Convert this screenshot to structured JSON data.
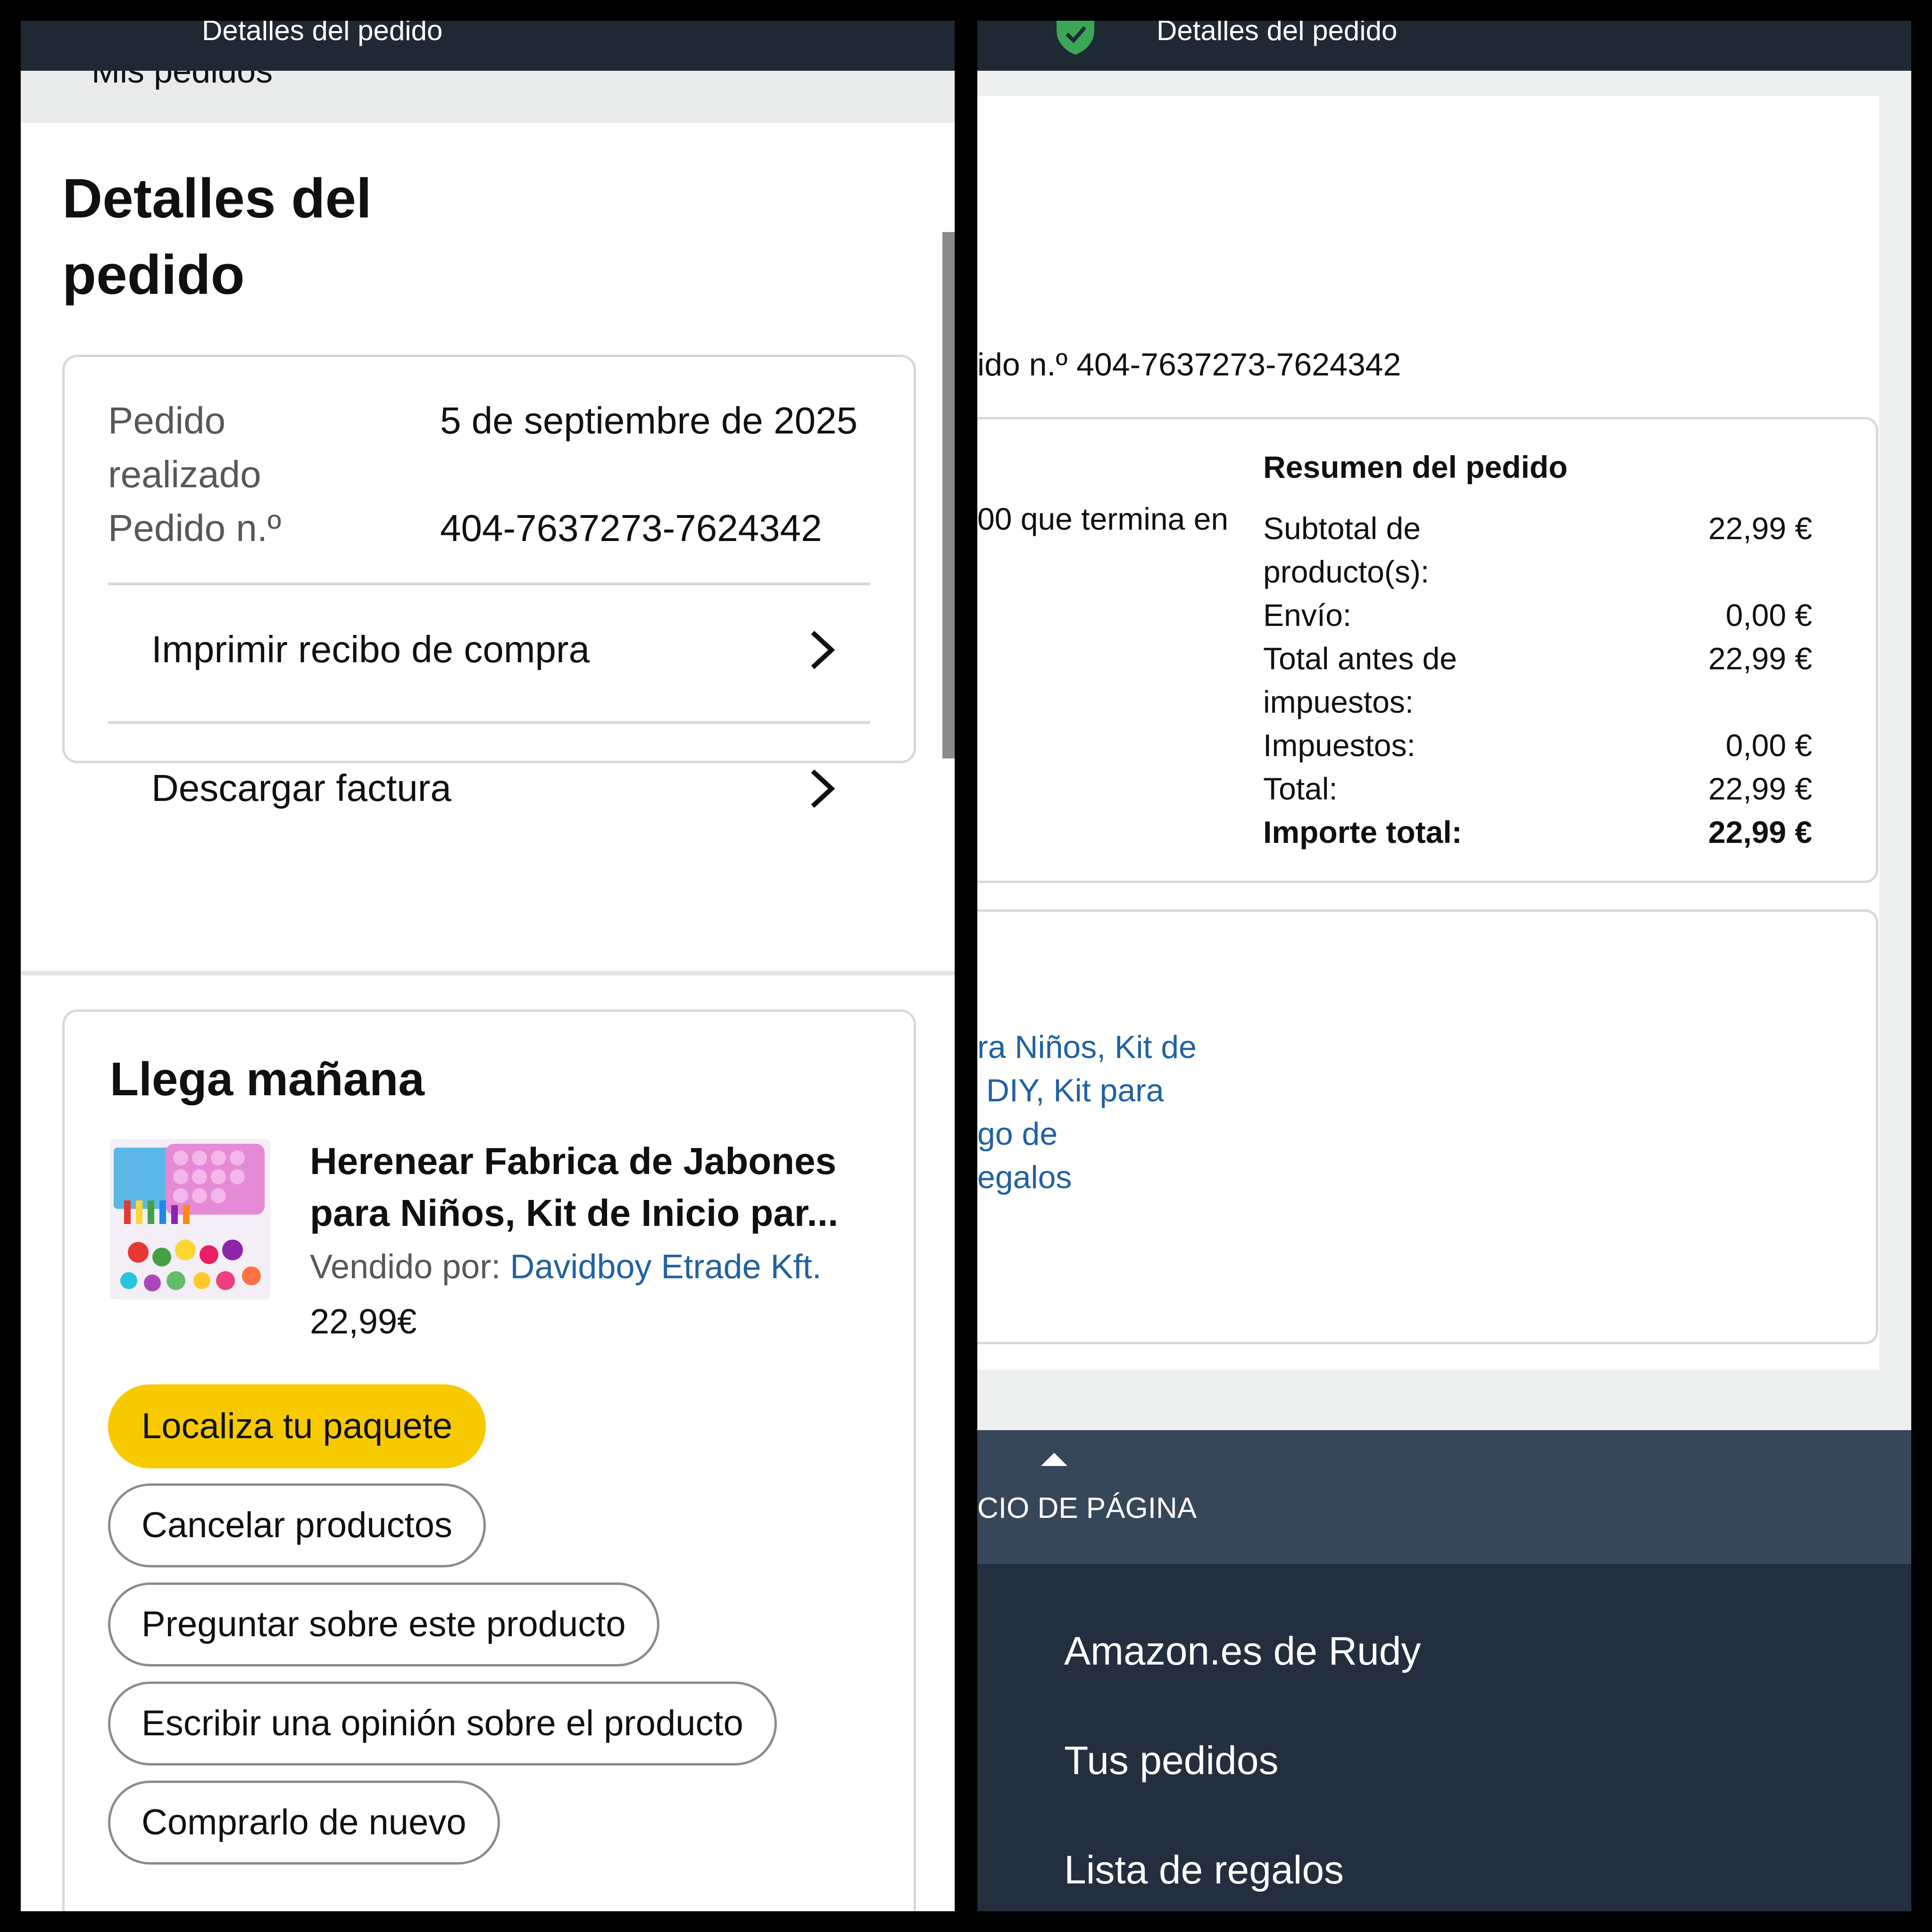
{
  "left": {
    "topbar_title": "Detalles del pedido",
    "breadcrumb": "Mis pedidos",
    "page_title": "Detalles del pedido",
    "info": {
      "placed_label": "Pedido realizado",
      "placed_value": "5 de septiembre de 2025",
      "order_label": "Pedido n.º",
      "order_value": "404-7637273-7624342",
      "print_receipt": "Imprimir recibo de compra",
      "download_invoice": "Descargar factura"
    },
    "shipment": {
      "title": "Llega mañana",
      "product_title_line1": "Herenear Fabrica de Jabones",
      "product_title_line2": "para Niños, Kit de Inicio par...",
      "sold_by_label": "Vendido por:",
      "seller": "Davidboy Etrade Kft.",
      "price": "22,99€",
      "buttons": {
        "track": "Localiza tu paquete",
        "cancel": "Cancelar productos",
        "ask": "Preguntar sobre este producto",
        "review": "Escribir una opinión sobre el producto",
        "buy_again": "Comprarlo de nuevo"
      }
    }
  },
  "right": {
    "topbar_title": "Detalles del pedido",
    "order_number_line": "ido n.º 404-7637273-7624342",
    "payment_fragment": "00  que termina en",
    "summary": {
      "title": "Resumen del pedido",
      "subtotal_label": "Subtotal de producto(s):",
      "subtotal_value": "22,99 €",
      "shipping_label": "Envío:",
      "shipping_value": "0,00 €",
      "pretax_label": "Total antes de impuestos:",
      "pretax_value": "22,99 €",
      "tax_label": "Impuestos:",
      "tax_value": "0,00 €",
      "total_label": "Total:",
      "total_value": "22,99 €",
      "grand_label": "Importe total:",
      "grand_value": "22,99 €"
    },
    "item_link": "ra Niños, Kit de\n DIY, Kit para\ngo de\negalos",
    "back_to_top": "CIO DE PÁGINA",
    "footer": {
      "link1": "Amazon.es de Rudy",
      "link2": "Tus pedidos",
      "link3": "Lista de regalos"
    }
  },
  "colors": {
    "header_bg": "#1f2933",
    "button_yellow": "#f7ca00",
    "link_blue": "#2162a1",
    "footer_bg": "#232f3e",
    "back_to_top_bg": "#37475a",
    "secure_green": "#3aa757"
  }
}
